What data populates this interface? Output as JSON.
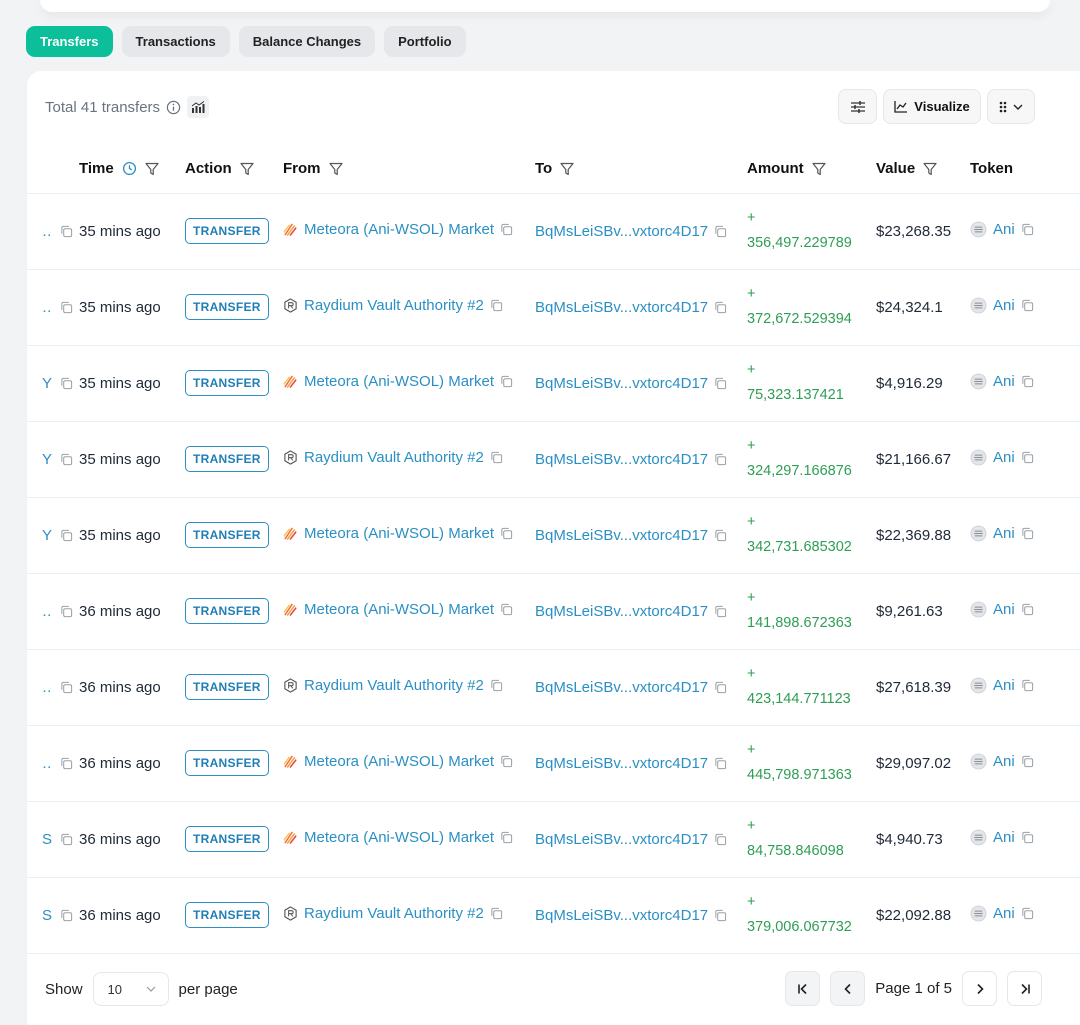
{
  "tabs": [
    {
      "label": "Transfers",
      "active": true
    },
    {
      "label": "Transactions",
      "active": false
    },
    {
      "label": "Balance Changes",
      "active": false
    },
    {
      "label": "Portfolio",
      "active": false
    }
  ],
  "header": {
    "total_text": "Total 41 transfers",
    "visualize_label": "Visualize"
  },
  "columns": {
    "time": "Time",
    "action": "Action",
    "from": "From",
    "to": "To",
    "amount": "Amount",
    "value": "Value",
    "token": "Token"
  },
  "rows": [
    {
      "sig": "…",
      "time": "35 mins ago",
      "action": "TRANSFER",
      "from": "Meteora (Ani-WSOL) Market",
      "from_icon": "meteora",
      "to": "BqMsLeiSBv...vxtorc4D17",
      "amount_sign": "+",
      "amount": "356,497.229789",
      "value": "$23,268.35",
      "token": "Ani"
    },
    {
      "sig": "…",
      "time": "35 mins ago",
      "action": "TRANSFER",
      "from": "Raydium Vault Authority #2",
      "from_icon": "raydium",
      "to": "BqMsLeiSBv...vxtorc4D17",
      "amount_sign": "+",
      "amount": "372,672.529394",
      "value": "$24,324.1",
      "token": "Ani"
    },
    {
      "sig": "Y…",
      "time": "35 mins ago",
      "action": "TRANSFER",
      "from": "Meteora (Ani-WSOL) Market",
      "from_icon": "meteora",
      "to": "BqMsLeiSBv...vxtorc4D17",
      "amount_sign": "+",
      "amount": "75,323.137421",
      "value": "$4,916.29",
      "token": "Ani"
    },
    {
      "sig": "Y…",
      "time": "35 mins ago",
      "action": "TRANSFER",
      "from": "Raydium Vault Authority #2",
      "from_icon": "raydium",
      "to": "BqMsLeiSBv...vxtorc4D17",
      "amount_sign": "+",
      "amount": "324,297.166876",
      "value": "$21,166.67",
      "token": "Ani"
    },
    {
      "sig": "Y…",
      "time": "35 mins ago",
      "action": "TRANSFER",
      "from": "Meteora (Ani-WSOL) Market",
      "from_icon": "meteora",
      "to": "BqMsLeiSBv...vxtorc4D17",
      "amount_sign": "+",
      "amount": "342,731.685302",
      "value": "$22,369.88",
      "token": "Ani"
    },
    {
      "sig": "…",
      "time": "36 mins ago",
      "action": "TRANSFER",
      "from": "Meteora (Ani-WSOL) Market",
      "from_icon": "meteora",
      "to": "BqMsLeiSBv...vxtorc4D17",
      "amount_sign": "+",
      "amount": "141,898.672363",
      "value": "$9,261.63",
      "token": "Ani"
    },
    {
      "sig": "…",
      "time": "36 mins ago",
      "action": "TRANSFER",
      "from": "Raydium Vault Authority #2",
      "from_icon": "raydium",
      "to": "BqMsLeiSBv...vxtorc4D17",
      "amount_sign": "+",
      "amount": "423,144.771123",
      "value": "$27,618.39",
      "token": "Ani"
    },
    {
      "sig": "…",
      "time": "36 mins ago",
      "action": "TRANSFER",
      "from": "Meteora (Ani-WSOL) Market",
      "from_icon": "meteora",
      "to": "BqMsLeiSBv...vxtorc4D17",
      "amount_sign": "+",
      "amount": "445,798.971363",
      "value": "$29,097.02",
      "token": "Ani"
    },
    {
      "sig": "S…",
      "time": "36 mins ago",
      "action": "TRANSFER",
      "from": "Meteora (Ani-WSOL) Market",
      "from_icon": "meteora",
      "to": "BqMsLeiSBv...vxtorc4D17",
      "amount_sign": "+",
      "amount": "84,758.846098",
      "value": "$4,940.73",
      "token": "Ani"
    },
    {
      "sig": "S…",
      "time": "36 mins ago",
      "action": "TRANSFER",
      "from": "Raydium Vault Authority #2",
      "from_icon": "raydium",
      "to": "BqMsLeiSBv...vxtorc4D17",
      "amount_sign": "+",
      "amount": "379,006.067732",
      "value": "$22,092.88",
      "token": "Ani"
    }
  ],
  "footer": {
    "show_label": "Show",
    "per_page_value": "10",
    "per_page_label": "per page",
    "page_text": "Page 1 of 5"
  },
  "colors": {
    "accent": "#0bbf9b",
    "link": "#2b8fc4",
    "positive": "#2f9e55"
  }
}
